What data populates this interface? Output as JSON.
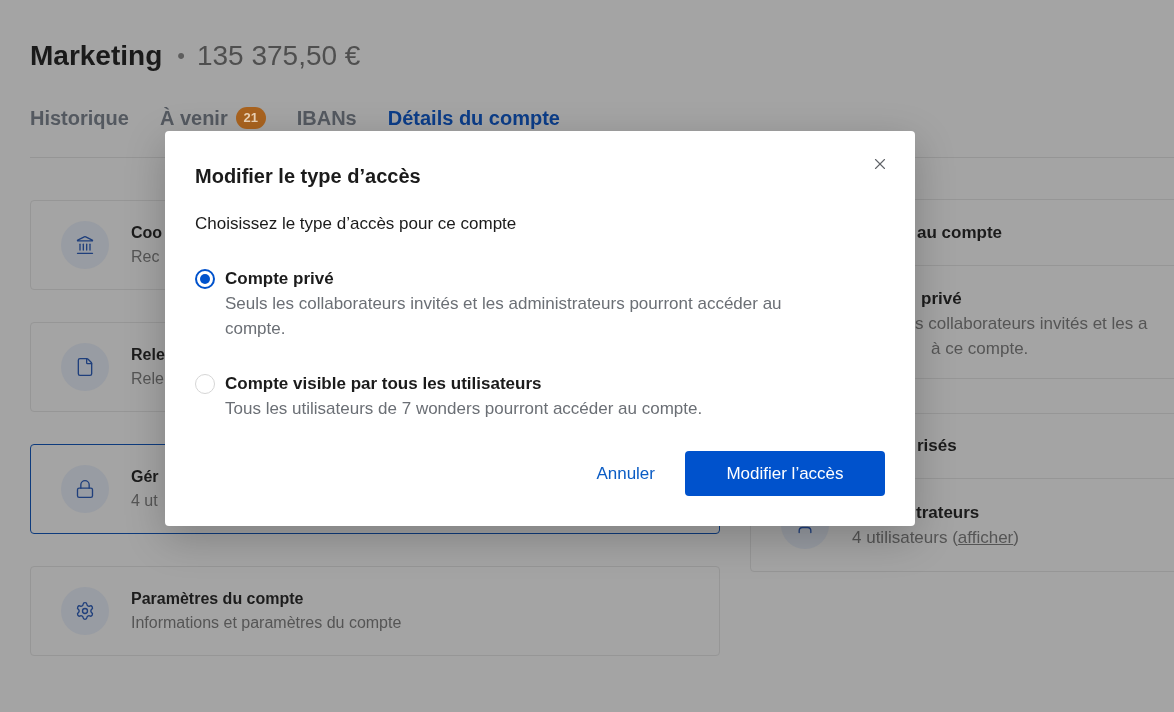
{
  "header": {
    "title": "Marketing",
    "separator": "•",
    "balance": "135 375,50 €"
  },
  "tabs": [
    {
      "label": "Historique",
      "selected": false
    },
    {
      "label": "À venir",
      "badge": "21",
      "selected": false
    },
    {
      "label": "IBANs",
      "selected": false
    },
    {
      "label": "Détails du compte",
      "selected": true
    }
  ],
  "account_cards": [
    {
      "kind": "bank",
      "title": "Coo",
      "subtitle": "Rec",
      "selected": false
    },
    {
      "kind": "document",
      "title": "Rele",
      "subtitle": "Rele",
      "selected": false
    },
    {
      "kind": "lock",
      "title": "Gér",
      "subtitle": "4 ut",
      "selected": true
    },
    {
      "kind": "settings",
      "title": "Paramètres du compte",
      "subtitle": "Informations et paramètres du compte",
      "selected": false
    }
  ],
  "side_panels": [
    {
      "heading": "au compte",
      "rows": [
        {
          "kind": "text",
          "title": "privé",
          "description_lines": [
            "s collaborateurs invités et les a",
            "à ce compte."
          ]
        }
      ]
    },
    {
      "heading": "risés",
      "rows": [
        {
          "kind": "people",
          "title": "trateurs",
          "text_before": "4 utilisateurs (",
          "link": "afficher",
          "text_after": ")"
        }
      ]
    }
  ],
  "dialog": {
    "title": "Modifier le type d’accès",
    "prompt": "Choisissez le type d’accès pour ce compte",
    "options": [
      {
        "label": "Compte privé",
        "description": "Seuls les collaborateurs invités et les administrateurs pourront accéder au compte.",
        "selected": true
      },
      {
        "label": "Compte visible par tous les utilisateurs",
        "description": "Tous les utilisateurs de 7 wonders pourront accéder au compte.",
        "selected": false
      }
    ],
    "buttons": [
      {
        "label": "Annuler",
        "kind": "link"
      },
      {
        "label": "Modifier l’accès",
        "kind": "primary"
      }
    ]
  }
}
